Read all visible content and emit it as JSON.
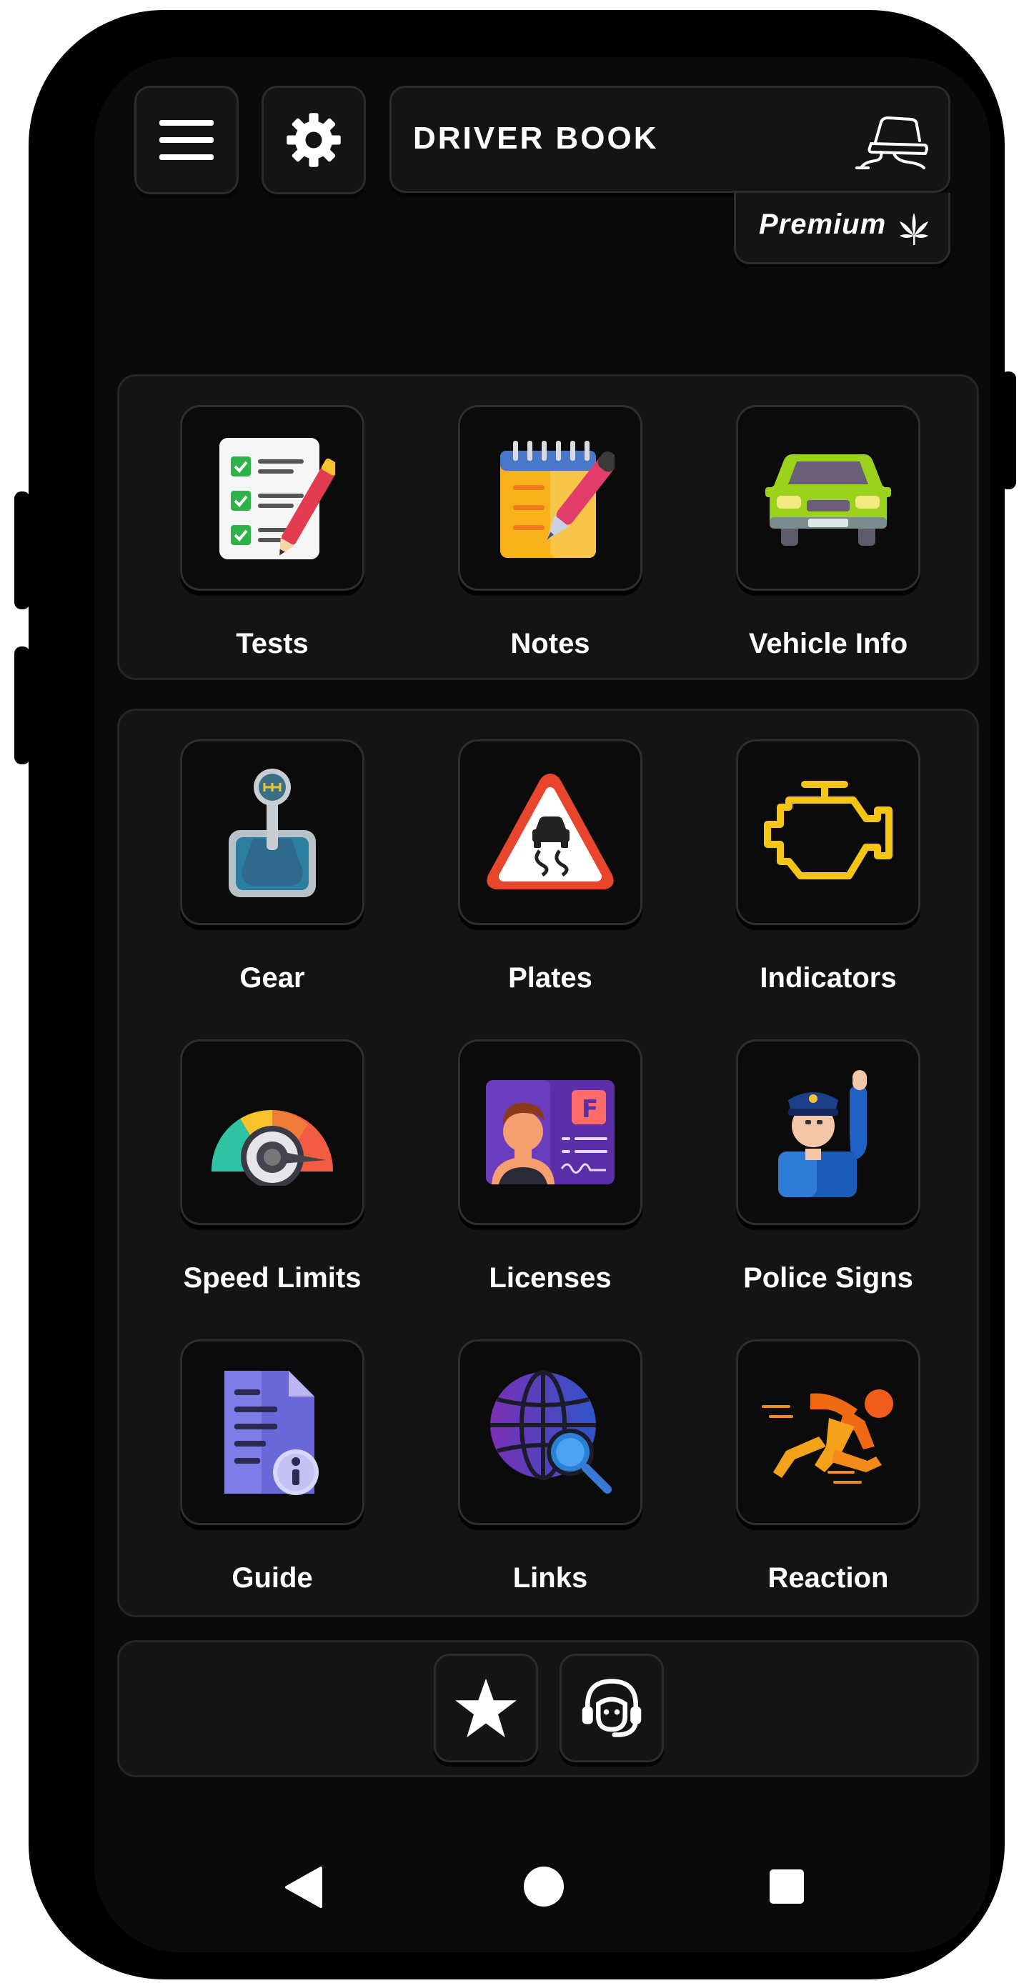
{
  "header": {
    "title": "DRIVER BOOK",
    "premium_label": "Premium"
  },
  "top_panel": {
    "items": [
      {
        "label": "Tests",
        "icon": "checklist-icon"
      },
      {
        "label": "Notes",
        "icon": "notepad-icon"
      },
      {
        "label": "Vehicle Info",
        "icon": "car-front-icon"
      }
    ]
  },
  "main_panel": {
    "items": [
      {
        "label": "Gear",
        "icon": "gear-shift-icon"
      },
      {
        "label": "Plates",
        "icon": "slippery-road-sign-icon"
      },
      {
        "label": "Indicators",
        "icon": "check-engine-icon"
      },
      {
        "label": "Speed Limits",
        "icon": "speedometer-icon"
      },
      {
        "label": "Licenses",
        "icon": "license-card-icon"
      },
      {
        "label": "Police Signs",
        "icon": "police-officer-icon"
      },
      {
        "label": "Guide",
        "icon": "document-info-icon"
      },
      {
        "label": "Links",
        "icon": "globe-search-icon"
      },
      {
        "label": "Reaction",
        "icon": "running-man-icon"
      }
    ]
  },
  "colors": {
    "background": "#0a0a0a",
    "panel": "#141414",
    "text": "#ffffff"
  }
}
